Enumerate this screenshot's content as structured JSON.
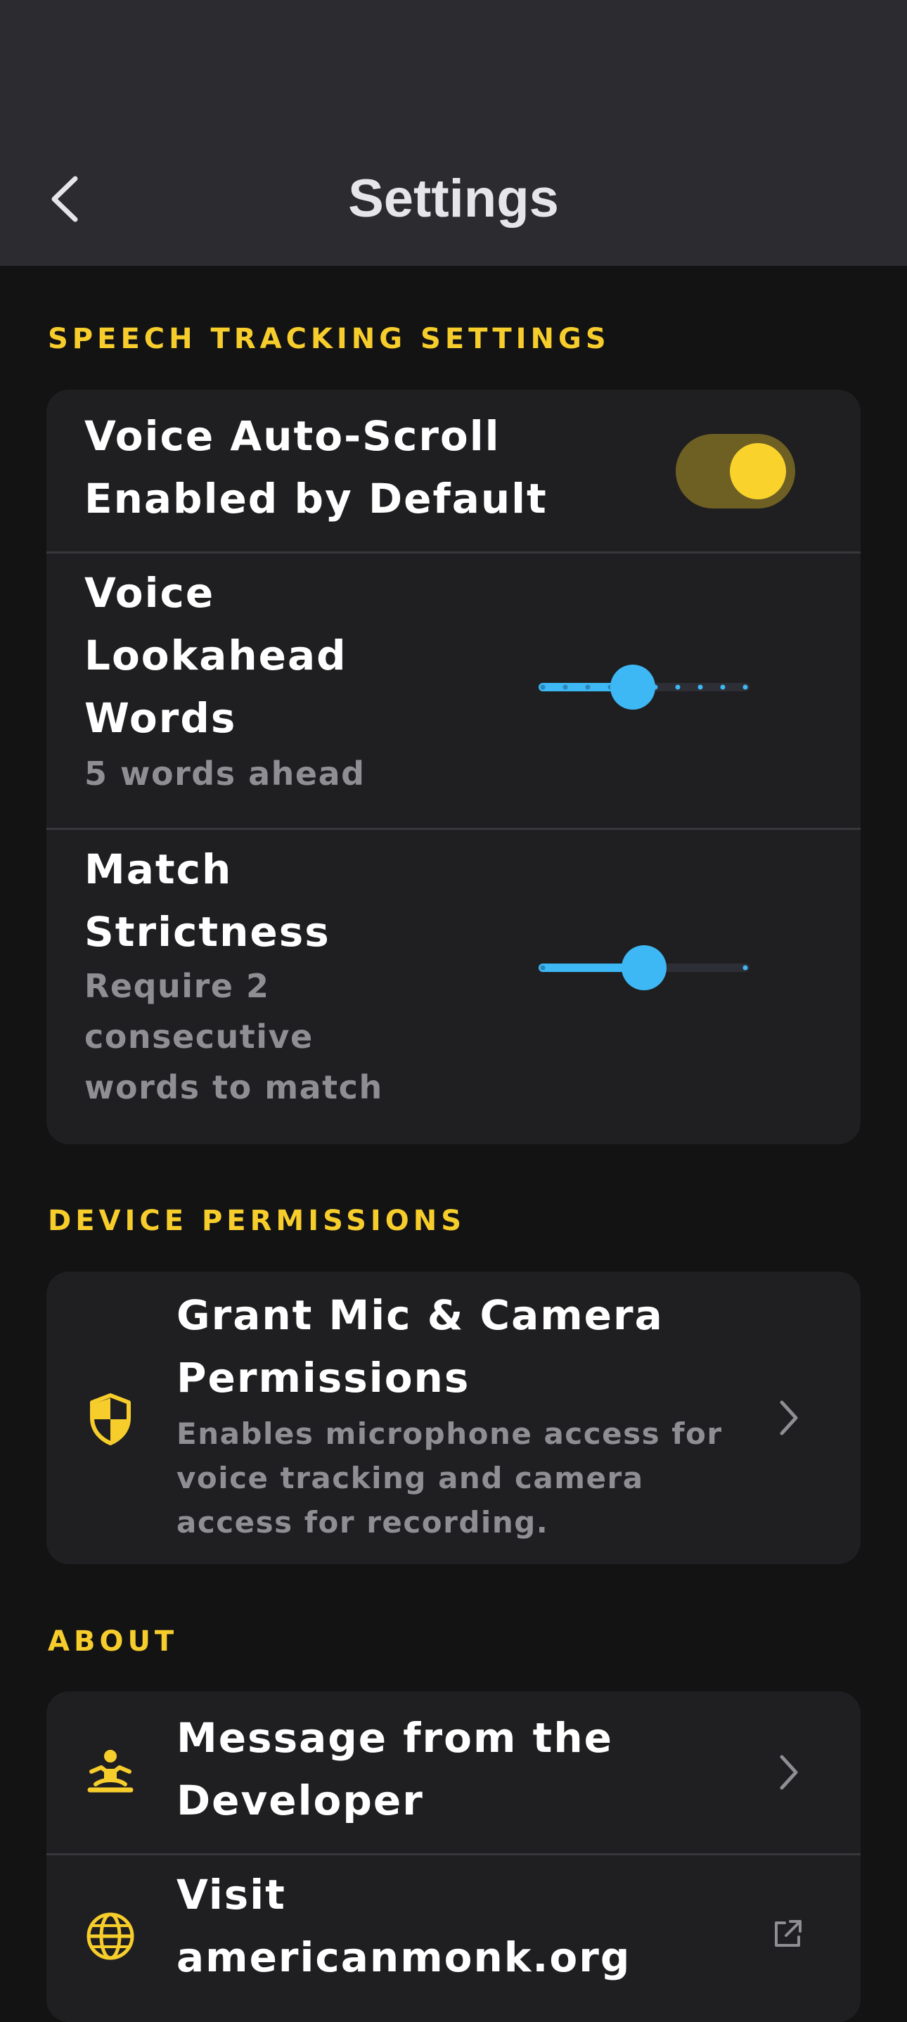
{
  "nav": {
    "title": "Settings",
    "back_icon": "chevron-left-icon"
  },
  "speech_tracking": {
    "header": "SPEECH TRACKING SETTINGS",
    "auto_scroll": {
      "title_line1": "Voice Auto-Scroll",
      "title_line2": "Enabled by Default",
      "enabled": true
    },
    "lookahead": {
      "title_line1": "Voice",
      "title_line2": "Lookahead",
      "title_line3": "Words",
      "subtitle": "5 words ahead",
      "value": 5,
      "min": 1,
      "max": 10
    },
    "strictness": {
      "title_line1": "Match",
      "title_line2": "Strictness",
      "sub_line1": "Require 2",
      "sub_line2": "consecutive",
      "sub_line3": "words to match",
      "value": 2,
      "min": 1,
      "max": 3
    }
  },
  "device_permissions": {
    "header": "DEVICE PERMISSIONS",
    "grant": {
      "icon": "shield-icon",
      "title_line1": "Grant Mic & Camera",
      "title_line2": "Permissions",
      "desc_line1": "Enables microphone access for",
      "desc_line2": "voice tracking and camera",
      "desc_line3": "access for recording."
    }
  },
  "about": {
    "header": "ABOUT",
    "developer": {
      "icon": "meditation-icon",
      "title_line1": "Message from the",
      "title_line2": "Developer"
    },
    "website": {
      "icon": "globe-icon",
      "title_line1": "Visit",
      "title_line2": "americanmonk.org",
      "trailing_icon": "external-link-icon"
    }
  },
  "colors": {
    "accent_yellow": "#f7cd2c",
    "slider_blue": "#3db8f5",
    "toggle_track": "#6e5f23"
  }
}
